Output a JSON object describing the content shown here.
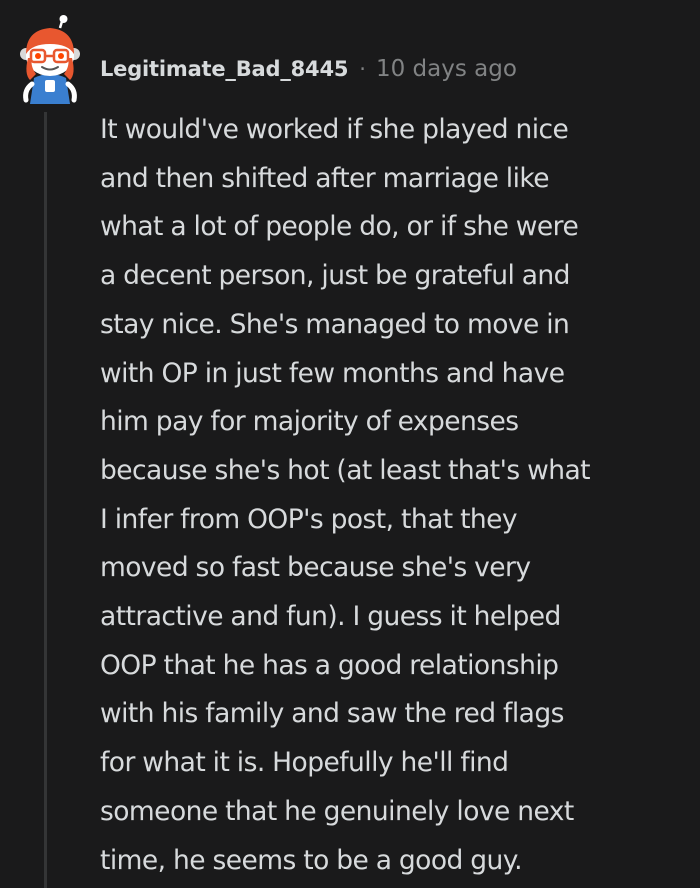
{
  "comment": {
    "author": "Legitimate_Bad_8445",
    "separator": "·",
    "timestamp": "10 days ago",
    "avatar_icon": "snoo-avatar-icon",
    "body_lines": [
      "It would've worked if she played nice",
      "and then shifted after marriage like",
      "what a lot of people do, or if she were",
      "a decent person, just be grateful and",
      "stay nice. She's managed to move in",
      "with OP in just few months and have",
      "him pay for majority of expenses",
      "because she's hot (at least that's what",
      "I infer from OOP's post, that they",
      "moved so fast because she's very",
      "attractive and fun). I guess it helped",
      "OOP that he has a good relationship",
      "with his family and saw the red flags",
      "for what it is. Hopefully he'll find",
      "someone that he genuinely love next",
      "time, he seems to be a good guy."
    ]
  },
  "colors": {
    "background": "#1a1a1b",
    "text": "#d7dadc",
    "meta_text": "#818384",
    "thread_line": "#343536",
    "avatar_accent": "#e8572f"
  }
}
